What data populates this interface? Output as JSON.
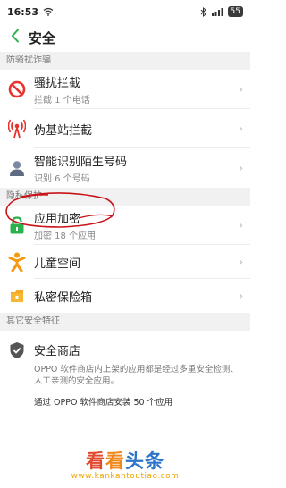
{
  "status": {
    "time": "16:53",
    "battery": "55"
  },
  "header": {
    "title": "安全"
  },
  "sections": {
    "anti_fraud": {
      "title": "防骚扰诈骗"
    },
    "privacy": {
      "title": "隐私保护"
    },
    "other": {
      "title": "其它安全特征"
    }
  },
  "items": {
    "harassment": {
      "label": "骚扰拦截",
      "sub": "拦截 1 个电话"
    },
    "fake_station": {
      "label": "伪基站拦截"
    },
    "number_id": {
      "label": "智能识别陌生号码",
      "sub": "识别 6 个号码"
    },
    "app_lock": {
      "label": "应用加密",
      "sub": "加密 18 个应用"
    },
    "kids": {
      "label": "儿童空间"
    },
    "safe_box": {
      "label": "私密保险箱"
    }
  },
  "store": {
    "label": "安全商店",
    "desc": "OPPO 软件商店内上架的应用都是经过多重安全检测、人工亲测的安全应用。",
    "count": "通过 OPPO 软件商店安装 50 个应用"
  },
  "colors": {
    "accent": "#2bb24c",
    "harassment": "#e8322e",
    "fake_station": "#e8322e",
    "kids": "#f29a10",
    "safe_box": "#f5a623",
    "annotation": "#c8141a"
  },
  "icons": {
    "back": "back-arrow-icon",
    "harassment": "block-icon",
    "fake_station": "signal-tower-icon",
    "number_id": "person-icon",
    "app_lock": "lock-icon",
    "kids": "child-icon",
    "safe_box": "safe-box-icon",
    "store": "shield-check-icon"
  },
  "watermark": {
    "logo_1": "看",
    "logo_2": "看",
    "logo_3": "头条",
    "url": "www.kankantoutiao.com"
  }
}
